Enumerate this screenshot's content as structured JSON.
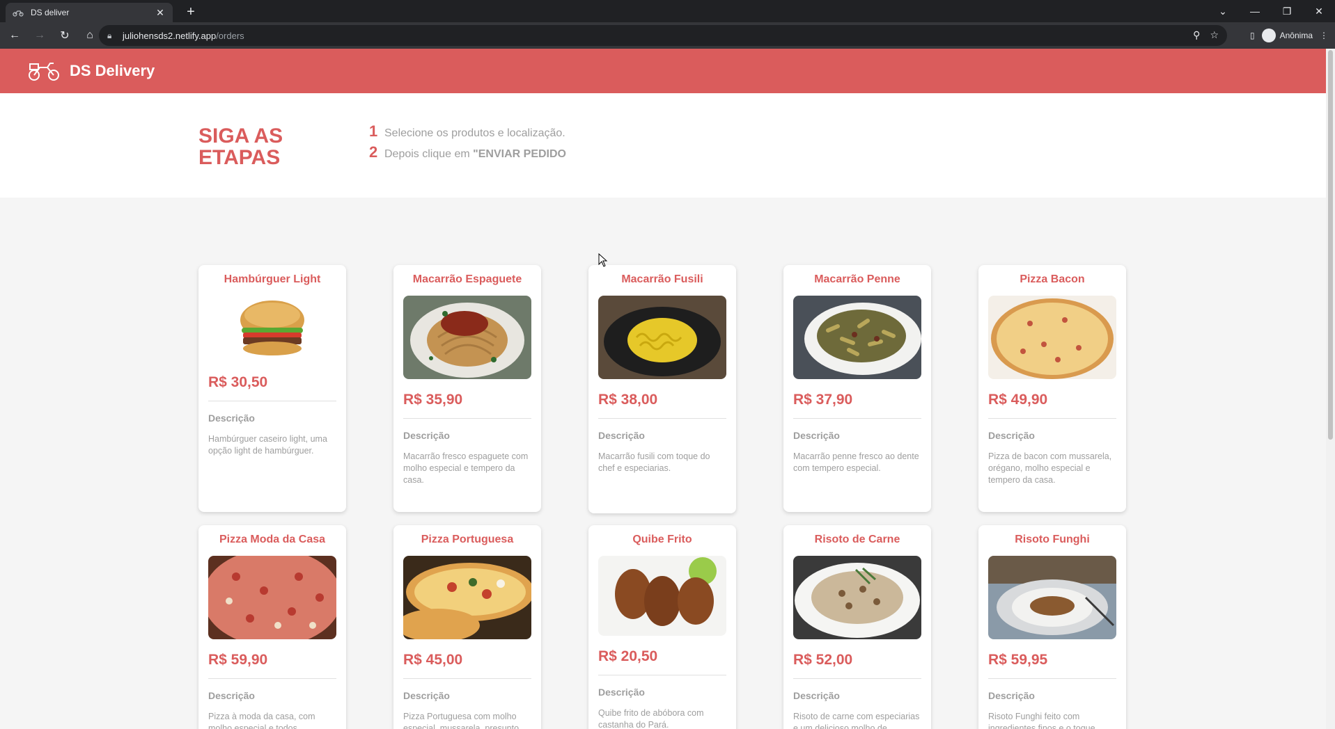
{
  "browser": {
    "tab_title": "DS deliver",
    "url_host": "juliohensds2.netlify.app",
    "url_path": "/orders",
    "profile_label": "Anônima"
  },
  "header": {
    "brand": "DS Delivery"
  },
  "steps": {
    "title": "SIGA AS ETAPAS",
    "items": [
      {
        "num": "1",
        "text": "Selecione os produtos e localização.",
        "bold": ""
      },
      {
        "num": "2",
        "text": "Depois clique em ",
        "bold": "\"ENVIAR PEDIDO"
      }
    ]
  },
  "desc_label": "Descrição",
  "products": [
    {
      "name": "Hambúrguer Light",
      "price": "R$ 30,50",
      "desc": "Hambúrguer caseiro light, uma opção light de hambúrguer.",
      "image": "burger"
    },
    {
      "name": "Macarrão Espaguete",
      "price": "R$ 35,90",
      "desc": "Macarrão fresco espaguete com molho especial e tempero da casa.",
      "image": "spaghetti"
    },
    {
      "name": "Macarrão Fusili",
      "price": "R$ 38,00",
      "desc": "Macarrão fusili com toque do chef e especiarias.",
      "image": "fusili"
    },
    {
      "name": "Macarrão Penne",
      "price": "R$ 37,90",
      "desc": "Macarrão penne fresco ao dente com tempero especial.",
      "image": "penne"
    },
    {
      "name": "Pizza Bacon",
      "price": "R$ 49,90",
      "desc": "Pizza de bacon com mussarela, orégano, molho especial e tempero da casa.",
      "image": "pizza-bacon"
    },
    {
      "name": "Pizza Moda da Casa",
      "price": "R$ 59,90",
      "desc": "Pizza à moda da casa, com molho especial e todos ingredientes básicos, e queijo à sua escolha.",
      "image": "pizza-casa"
    },
    {
      "name": "Pizza Portuguesa",
      "price": "R$ 45,00",
      "desc": "Pizza Portuguesa com molho especial, mussarela, presunto, ovos e especiarias.",
      "image": "pizza-portuguesa"
    },
    {
      "name": "Quibe Frito",
      "price": "R$ 20,50",
      "desc": "Quibe frito de abóbora com castanha do Pará.",
      "image": "quibe"
    },
    {
      "name": "Risoto de Carne",
      "price": "R$ 52,00",
      "desc": "Risoto de carne com especiarias e um delicioso molho de acompanhamento.",
      "image": "risoto-carne"
    },
    {
      "name": "Risoto Funghi",
      "price": "R$ 59,95",
      "desc": "Risoto Funghi feito com ingredientes finos e o toque especial do chef.",
      "image": "risoto-funghi"
    }
  ],
  "colors": {
    "primary": "#da5c5c",
    "muted": "#9e9e9e"
  }
}
